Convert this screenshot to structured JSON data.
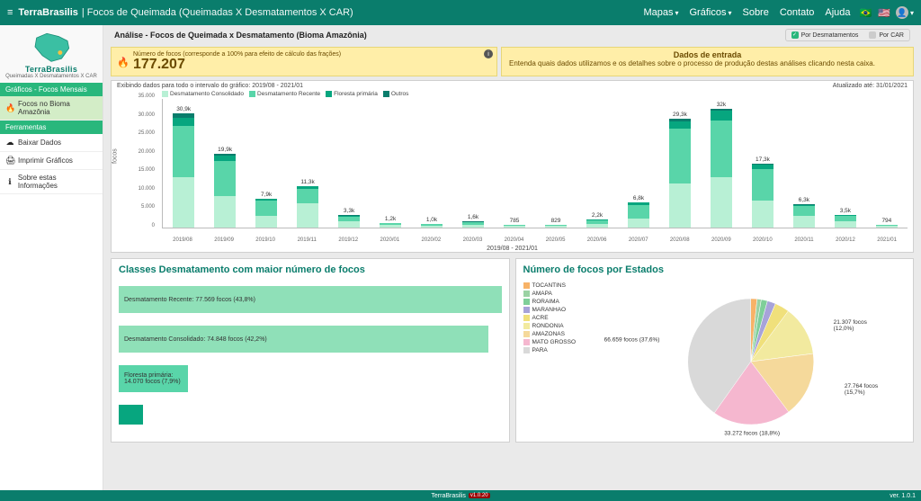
{
  "nav": {
    "brand": "TerraBrasilis",
    "page_title": "| Focos de Queimada (Queimadas X Desmatamentos X CAR)",
    "links": {
      "mapas": "Mapas",
      "graficos": "Gráficos",
      "sobre": "Sobre",
      "contato": "Contato",
      "ajuda": "Ajuda"
    },
    "flag_br": "🇧🇷",
    "flag_us": "🇺🇸"
  },
  "sidebar": {
    "brand": "TerraBrasilis",
    "sub": "Queimadas X Desmatamentos X CAR",
    "group1": "Gráficos - Focos Mensais",
    "item_bioma": "Focos no Bioma Amazônia",
    "group2": "Ferramentas",
    "item_baixar": "Baixar Dados",
    "item_imprimir": "Imprimir Gráficos",
    "item_sobre": "Sobre estas Informações"
  },
  "header": {
    "title": "Análise - Focos de Queimada x Desmatamento (Bioma Amazônia)",
    "toggle_desmat": "Por Desmatamentos",
    "toggle_car": "Por CAR"
  },
  "counter": {
    "label": "Número de focos (corresponde a 100% para efeito de cálculo das frações)",
    "value": "177.207"
  },
  "info_box": {
    "title": "Dados de entrada",
    "text": "Entenda quais dados utilizamos e os detalhes sobre o processo de produção destas análises clicando nesta caixa."
  },
  "main_chart_meta": {
    "range_label": "Exibindo dados para todo o intervalo do gráfico:  2019/08 - 2021/01",
    "updated": "Atualizado até: 31/01/2021",
    "x_caption": "2019/08 - 2021/01",
    "y_label": "focos",
    "legend": {
      "consolidado": "Desmatamento Consolidado",
      "recente": "Desmatamento Recente",
      "floresta": "Floresta primária",
      "outros": "Outros"
    }
  },
  "chart_data": [
    {
      "type": "bar",
      "stacked": true,
      "title": "Análise - Focos de Queimada x Desmatamento (Bioma Amazônia)",
      "ylabel": "focos",
      "ylim": [
        0,
        35000
      ],
      "y_ticks": [
        0,
        5000,
        10000,
        15000,
        20000,
        25000,
        30000,
        35000
      ],
      "categories": [
        "2019/08",
        "2019/09",
        "2019/10",
        "2019/11",
        "2019/12",
        "2020/01",
        "2020/02",
        "2020/03",
        "2020/04",
        "2020/05",
        "2020/06",
        "2020/07",
        "2020/08",
        "2020/09",
        "2020/10",
        "2020/11",
        "2020/12",
        "2021/01"
      ],
      "totals_label": [
        "30,9k",
        "19,9k",
        "7,9k",
        "11,3k",
        "3,3k",
        "1,2k",
        "1,0k",
        "1,6k",
        "785",
        "829",
        "2,2k",
        "6,8k",
        "29,3k",
        "32k",
        "17,3k",
        "6,3k",
        "3,5k",
        "794"
      ],
      "series": [
        {
          "name": "Desmatamento Consolidado",
          "color": "#b8f0d5",
          "values": [
            13500,
            8500,
            3200,
            6500,
            1600,
            650,
            500,
            800,
            380,
            400,
            900,
            2400,
            12000,
            13500,
            7200,
            3200,
            1700,
            400
          ]
        },
        {
          "name": "Desmatamento Recente",
          "color": "#59d5a9",
          "values": [
            14000,
            9500,
            4000,
            4000,
            1400,
            450,
            400,
            650,
            320,
            340,
            1100,
            3800,
            14800,
            15500,
            8600,
            2700,
            1500,
            300
          ]
        },
        {
          "name": "Floresta primária",
          "color": "#07a67f",
          "values": [
            2200,
            1400,
            500,
            600,
            200,
            80,
            80,
            120,
            60,
            60,
            150,
            500,
            2000,
            2500,
            1200,
            300,
            250,
            70
          ]
        },
        {
          "name": "Outros",
          "color": "#0a7d6c",
          "values": [
            1200,
            500,
            200,
            200,
            100,
            20,
            20,
            30,
            25,
            29,
            50,
            100,
            500,
            500,
            300,
            100,
            50,
            24
          ]
        }
      ]
    },
    {
      "type": "bar-horizontal",
      "title": "Classes Desmatamento com maior número de focos",
      "categories": [
        "Desmatamento Recente",
        "Desmatamento Consolidado",
        "Floresta primária",
        ""
      ],
      "values_label": [
        "77.569 focos (43,8%)",
        "74.848 focos (42,2%)",
        "14.070 focos (7,9%)",
        ""
      ],
      "values": [
        77569,
        74848,
        14070,
        5000
      ]
    },
    {
      "type": "pie",
      "title": "Número de focos por Estados",
      "slices": [
        {
          "name": "TOCANTINS",
          "color": "#f7b267",
          "value": 1.5
        },
        {
          "name": "AMAPA",
          "color": "#9ad2a3",
          "value": 1.0
        },
        {
          "name": "RORAIMA",
          "color": "#7fcf99",
          "value": 1.5
        },
        {
          "name": "MARANHAO",
          "color": "#a7a3d9",
          "value": 2.0
        },
        {
          "name": "ACRE",
          "color": "#f0e07b",
          "value": 3.5
        },
        {
          "name": "RONDONIA",
          "color": "#f2ea9f",
          "value": 12.0,
          "label": "21.307 focos (12,0%)"
        },
        {
          "name": "AMAZONAS",
          "color": "#f5d99b",
          "value": 15.7,
          "label": "27.764 focos (15,7%)"
        },
        {
          "name": "MATO GROSSO",
          "color": "#f5b7cf",
          "value": 18.8,
          "label": "33.272 focos (18,8%)"
        },
        {
          "name": "PARA",
          "color": "#d9d9d9",
          "value": 37.6,
          "label": "66.659 focos (37,6%)"
        }
      ]
    }
  ],
  "panels": {
    "classes_title": "Classes Desmatamento com maior número de focos",
    "states_title": "Número de focos por Estados"
  },
  "footer": {
    "brand": "TerraBrasilis",
    "badge": "v1.0.20",
    "ver": "ver. 1.0.1"
  }
}
